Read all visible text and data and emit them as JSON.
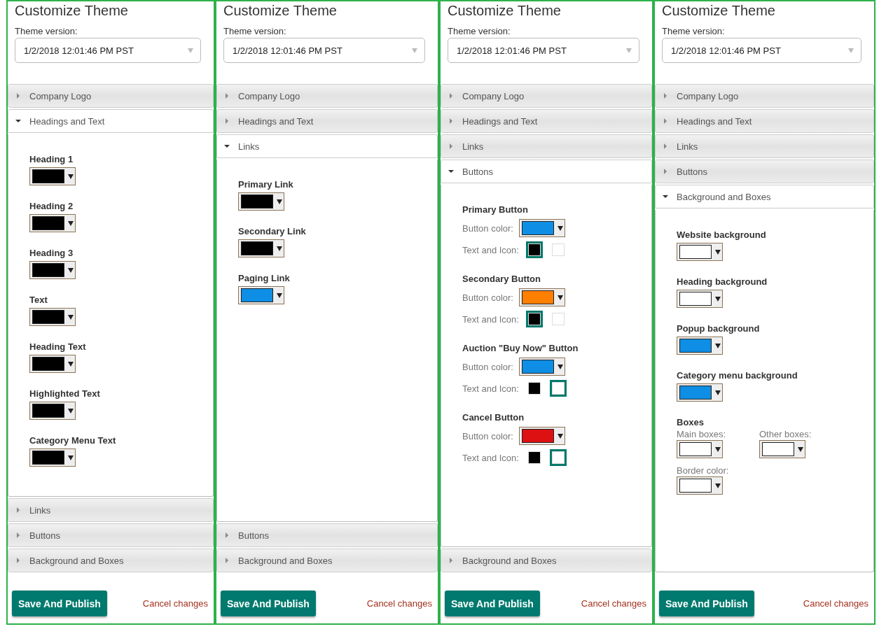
{
  "panels": [
    {
      "title": "Customize Theme",
      "version_label": "Theme version:",
      "version": "1/2/2018 12:01:46 PM PST",
      "sections": [
        {
          "title": "Company Logo",
          "expanded": false
        },
        {
          "title": "Headings and Text",
          "expanded": true,
          "fields": [
            {
              "kind": "color",
              "label": "Heading 1",
              "color": "#000000"
            },
            {
              "kind": "color",
              "label": "Heading 2",
              "color": "#000000"
            },
            {
              "kind": "color",
              "label": "Heading 3",
              "color": "#000000"
            },
            {
              "kind": "color",
              "label": "Text",
              "color": "#000000"
            },
            {
              "kind": "color",
              "label": "Heading Text",
              "color": "#000000"
            },
            {
              "kind": "color",
              "label": "Highlighted Text",
              "color": "#000000"
            },
            {
              "kind": "color",
              "label": "Category Menu Text",
              "color": "#000000"
            }
          ]
        },
        {
          "title": "Links",
          "expanded": false
        },
        {
          "title": "Buttons",
          "expanded": false
        },
        {
          "title": "Background and Boxes",
          "expanded": false
        }
      ],
      "save": "Save And Publish",
      "cancel": "Cancel changes"
    },
    {
      "title": "Customize Theme",
      "version_label": "Theme version:",
      "version": "1/2/2018 12:01:46 PM PST",
      "sections": [
        {
          "title": "Company Logo",
          "expanded": false
        },
        {
          "title": "Headings and Text",
          "expanded": false
        },
        {
          "title": "Links",
          "expanded": true,
          "fields": [
            {
              "kind": "color",
              "label": "Primary Link",
              "color": "#000000"
            },
            {
              "kind": "color",
              "label": "Secondary Link",
              "color": "#000000"
            },
            {
              "kind": "color",
              "label": "Paging Link",
              "color": "#0e8ee4"
            }
          ]
        },
        {
          "title": "Buttons",
          "expanded": false
        },
        {
          "title": "Background and Boxes",
          "expanded": false
        }
      ],
      "save": "Save And Publish",
      "cancel": "Cancel changes"
    },
    {
      "title": "Customize Theme",
      "version_label": "Theme version:",
      "version": "1/2/2018 12:01:46 PM PST",
      "sections": [
        {
          "title": "Company Logo",
          "expanded": false
        },
        {
          "title": "Headings and Text",
          "expanded": false
        },
        {
          "title": "Links",
          "expanded": false
        },
        {
          "title": "Buttons",
          "expanded": true,
          "fields": [
            {
              "kind": "button",
              "label": "Primary Button",
              "color_label": "Button color:",
              "color": "#0e8ee4",
              "text_label": "Text and Icon:",
              "options": [
                {
                  "color": "#000000",
                  "selected": true
                },
                {
                  "color": "#ffffff",
                  "selected": false
                }
              ]
            },
            {
              "kind": "button",
              "label": "Secondary Button",
              "color_label": "Button color:",
              "color": "#ff7f00",
              "text_label": "Text and Icon:",
              "options": [
                {
                  "color": "#000000",
                  "selected": true
                },
                {
                  "color": "#ffffff",
                  "selected": false
                }
              ]
            },
            {
              "kind": "button",
              "label": "Auction \"Buy Now\" Button",
              "color_label": "Button color:",
              "color": "#0e8ee4",
              "text_label": "Text and Icon:",
              "options": [
                {
                  "color": "#000000",
                  "selected": false
                },
                {
                  "color": "#ffffff",
                  "selected": true
                }
              ]
            },
            {
              "kind": "button",
              "label": "Cancel Button",
              "color_label": "Button color:",
              "color": "#dd1111",
              "text_label": "Text and Icon:",
              "options": [
                {
                  "color": "#000000",
                  "selected": false
                },
                {
                  "color": "#ffffff",
                  "selected": true
                }
              ]
            }
          ]
        },
        {
          "title": "Background and Boxes",
          "expanded": false
        }
      ],
      "save": "Save And Publish",
      "cancel": "Cancel changes"
    },
    {
      "title": "Customize Theme",
      "version_label": "Theme version:",
      "version": "1/2/2018 12:01:46 PM PST",
      "sections": [
        {
          "title": "Company Logo",
          "expanded": false
        },
        {
          "title": "Headings and Text",
          "expanded": false
        },
        {
          "title": "Links",
          "expanded": false
        },
        {
          "title": "Buttons",
          "expanded": false
        },
        {
          "title": "Background and Boxes",
          "expanded": true,
          "fields": [
            {
              "kind": "color",
              "label": "Website background",
              "color": "#ffffff"
            },
            {
              "kind": "color",
              "label": "Heading background",
              "color": "#ffffff"
            },
            {
              "kind": "color",
              "label": "Popup background",
              "color": "#0e8ee4"
            },
            {
              "kind": "color",
              "label": "Category menu background",
              "color": "#0e8ee4"
            },
            {
              "kind": "boxes",
              "label": "Boxes",
              "items": [
                {
                  "label": "Main boxes:",
                  "color": "#ffffff"
                },
                {
                  "label": "Other boxes:",
                  "color": "#ffffff"
                },
                {
                  "label": "Border color:",
                  "color": "#ffffff"
                }
              ]
            }
          ]
        }
      ],
      "save": "Save And Publish",
      "cancel": "Cancel changes"
    }
  ]
}
